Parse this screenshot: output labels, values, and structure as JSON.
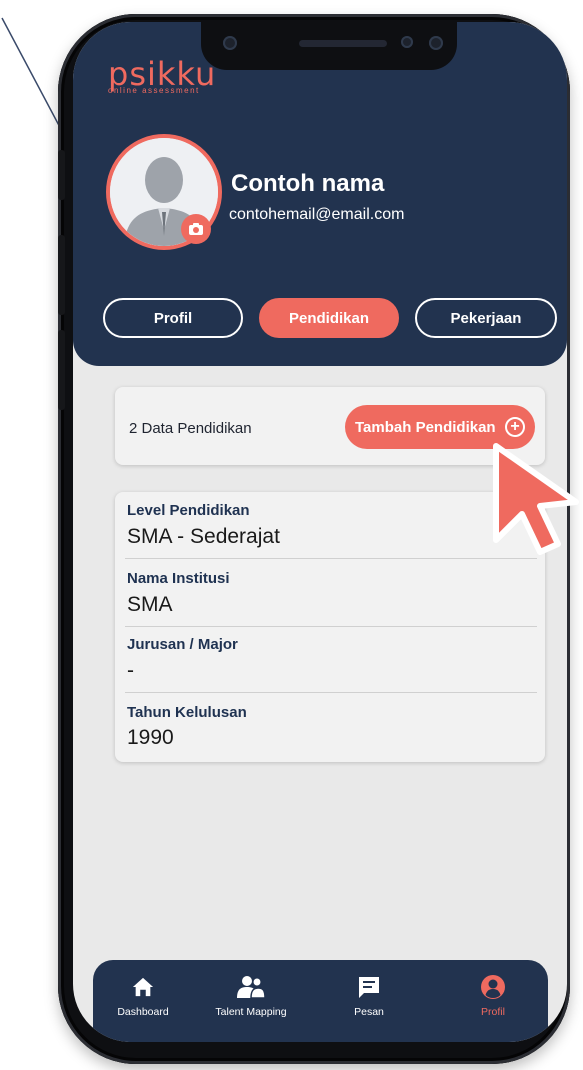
{
  "app": {
    "logo_text": "psikku",
    "logo_subtitle": "online assessment"
  },
  "profile": {
    "name": "Contoh nama",
    "email": "contohemail@email.com"
  },
  "tabs": [
    {
      "label": "Profil",
      "active": false
    },
    {
      "label": "Pendidikan",
      "active": true
    },
    {
      "label": "Pekerjaan",
      "active": false
    }
  ],
  "education": {
    "count_text": "2 Data Pendidikan",
    "add_button_label": "Tambah Pendidikan",
    "fields": [
      {
        "label": "Level Pendidikan",
        "value": "SMA - Sederajat"
      },
      {
        "label": "Nama Institusi",
        "value": "SMA"
      },
      {
        "label": "Jurusan / Major",
        "value": "-"
      },
      {
        "label": "Tahun Kelulusan",
        "value": "1990"
      }
    ]
  },
  "nav": [
    {
      "label": "Dashboard",
      "icon": "home-icon",
      "active": false
    },
    {
      "label": "Talent Mapping",
      "icon": "users-icon",
      "active": false
    },
    {
      "label": "Pesan",
      "icon": "message-icon",
      "active": false
    },
    {
      "label": "Profil",
      "icon": "user-circle-icon",
      "active": true
    }
  ],
  "colors": {
    "primary_navy": "#22334f",
    "accent_coral": "#ef6a5f",
    "background": "#e9e9e9"
  }
}
